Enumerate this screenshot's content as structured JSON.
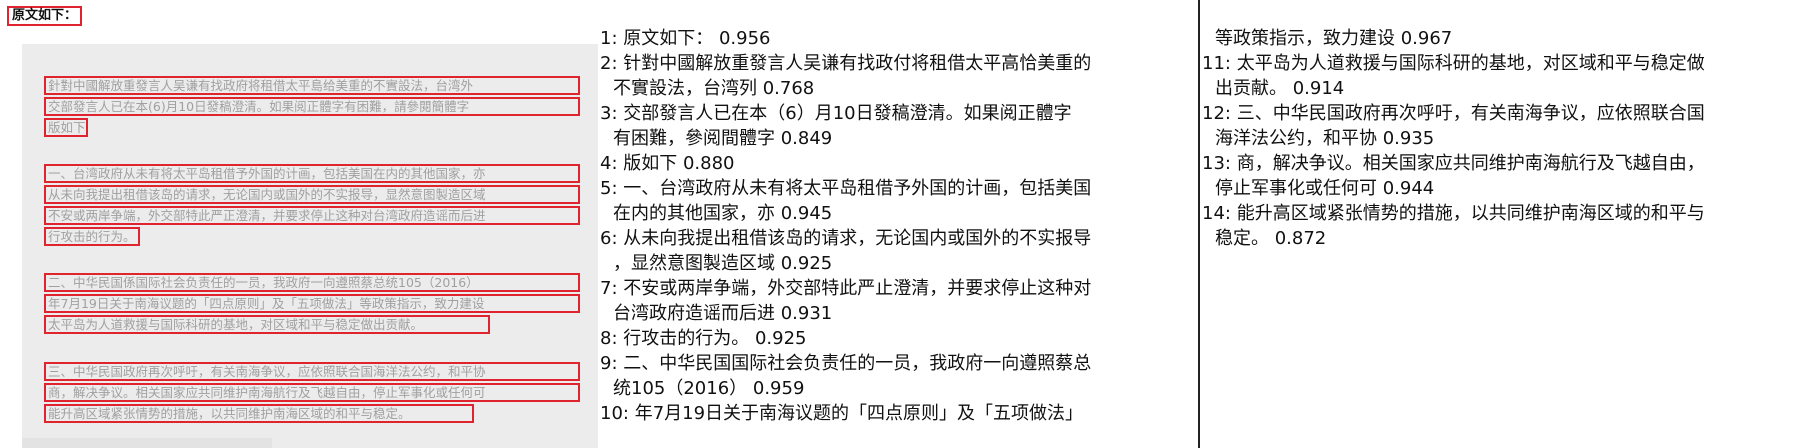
{
  "source_panel": {
    "header": "原文如下：",
    "lines": [
      "針對中國解放重發言人吴谦有找政府将租借太平島给美重的不實設法，台湾外",
      "交部發言人已在本(6)月10日發稿澄清。如果阅正體字有困難，請參閱簡體字",
      "版如下",
      "一、台湾政府从未有将太平岛租借予外国的计画，包括美国在内的其他国家，亦",
      "从未向我提出租借该岛的请求，无论国内或国外的不实报导，显然意图製造区域",
      "不安或两岸争端，外交部特此严正澄清，并要求停止这种对台湾政府造谣而后进",
      "行攻击的行为。",
      "二、中华民国係国际社会负责任的一员，我政府一向遵照蔡总统105（2016）",
      "年7月19日关于南海议题的「四点原则」及「五项做法」等政策指示，致力建设",
      "太平岛为人道救援与国际科研的基地，对区域和平与稳定做出贡献。",
      "三、中华民国政府再次呼吁，有关南海争议，应依照联合国海洋法公约，和平协",
      "商，解决争议。相关国家应共同维护南海航行及飞越自由，停止军事化或任何可",
      "能升高区域紧张情势的措施，以共同维护南海区域的和平与稳定。"
    ]
  },
  "results_col1": [
    "1: 原文如下：   0.956",
    "2: 针對中國解放重發言人吴谦有找政付将租借太平高恰美重的",
    "不實設法，台湾列  0.768",
    "3: 交部發言人已在本（6）月10日發稿澄清。如果阅正體字",
    "有困難，參阅間體字  0.849",
    "4: 版如下   0.880",
    "5: 一、台湾政府从未有将太平岛租借予外国的计画，包括美国",
    "在内的其他国家，亦  0.945",
    "6: 从未向我提出租借该岛的请求，无论国内或国外的不实报导",
    "，显然意图製造区域  0.925",
    "7: 不安或两岸争端，外交部特此严止澄清，并要求停止这种对",
    "台湾政府造谣而后进  0.931",
    "8: 行攻击的行为。   0.925",
    "9: 二、中华民国国际社会负责任的一员，我政府一向遵照蔡总",
    "统105（2016）   0.959",
    "10: 年7月19日关于南海议题的「四点原则」及「五项做法」"
  ],
  "results_col2": [
    "等政策指示，致力建设  0.967",
    "11: 太平岛为人道救援与国际科研的基地，对区域和平与稳定做",
    "出贡献。  0.914",
    "12: 三、中华民国政府再次呼吁，有关南海争议，应依照联合国",
    "海洋法公约，和平协  0.935",
    "13: 商，解决争议。相关国家应共同维护南海航行及飞越自由，",
    "停止军事化或任何可  0.944",
    "14: 能升高区域紧张情势的措施，以共同维护南海区域的和平与",
    "稳定。   0.872"
  ],
  "colors": {
    "box": "#e0242f",
    "page": "#ececec",
    "divider": "#222222"
  }
}
